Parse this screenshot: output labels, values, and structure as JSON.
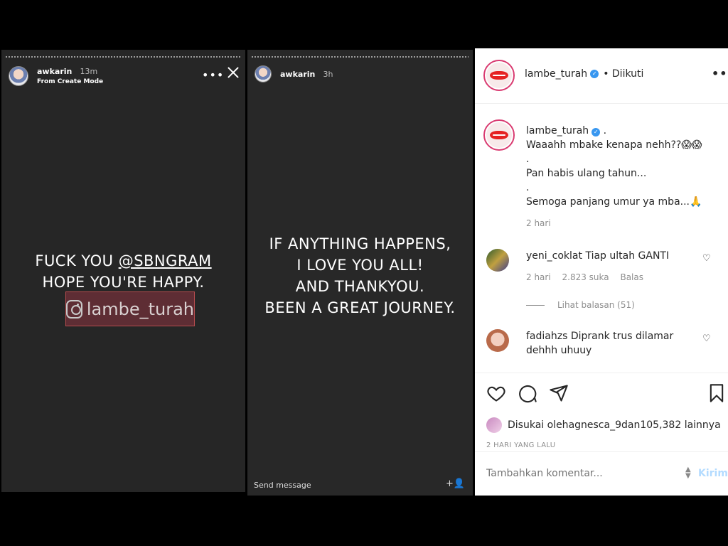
{
  "story1": {
    "username": "awkarin",
    "time": "13m",
    "subtitle": "From Create Mode",
    "line1_prefix": "FUCK YOU ",
    "line1_mention": "@SBNGRAM",
    "line2": "HOPE YOU'RE HAPPY.",
    "sticker_label": "lambe_turah"
  },
  "story2": {
    "username": "awkarin",
    "time": "3h",
    "lines": [
      "IF ANYTHING HAPPENS,",
      "I LOVE YOU ALL!",
      "AND THANKYOU.",
      "BEEN A GREAT JOURNEY."
    ],
    "send_message": "Send message"
  },
  "post": {
    "header": {
      "username": "lambe_turah",
      "follow_status": "• Diikuti"
    },
    "caption": {
      "username": "lambe_turah",
      "suffix": " .",
      "lines": [
        "Waaahh mbake kenapa nehh??😱😱",
        ".",
        "Pan habis ulang tahun...",
        ".",
        "Semoga panjang umur ya mba...🙏"
      ],
      "time": "2 hari"
    },
    "comments": [
      {
        "username": "yeni_coklat",
        "text": "Tiap ultah GANTI",
        "time": "2 hari",
        "likes": "2.823 suka",
        "reply": "Balas"
      },
      {
        "username": "fadiahzs",
        "text": "Diprank trus dilamar dehhh uhuuy"
      }
    ],
    "view_replies": "Lihat balasan (51)",
    "likes_prefix": "Disukai oleh ",
    "likes_user": "agnesca_9",
    "likes_middle": " dan ",
    "likes_count": "105,382 lainnya",
    "date": "2 HARI YANG LALU",
    "comment_placeholder": "Tambahkan komentar...",
    "post_button": "Kirim"
  },
  "colors": {
    "story_bg": "#262626",
    "verified": "#3897f0",
    "post_button_disabled": "#b3dbff"
  }
}
